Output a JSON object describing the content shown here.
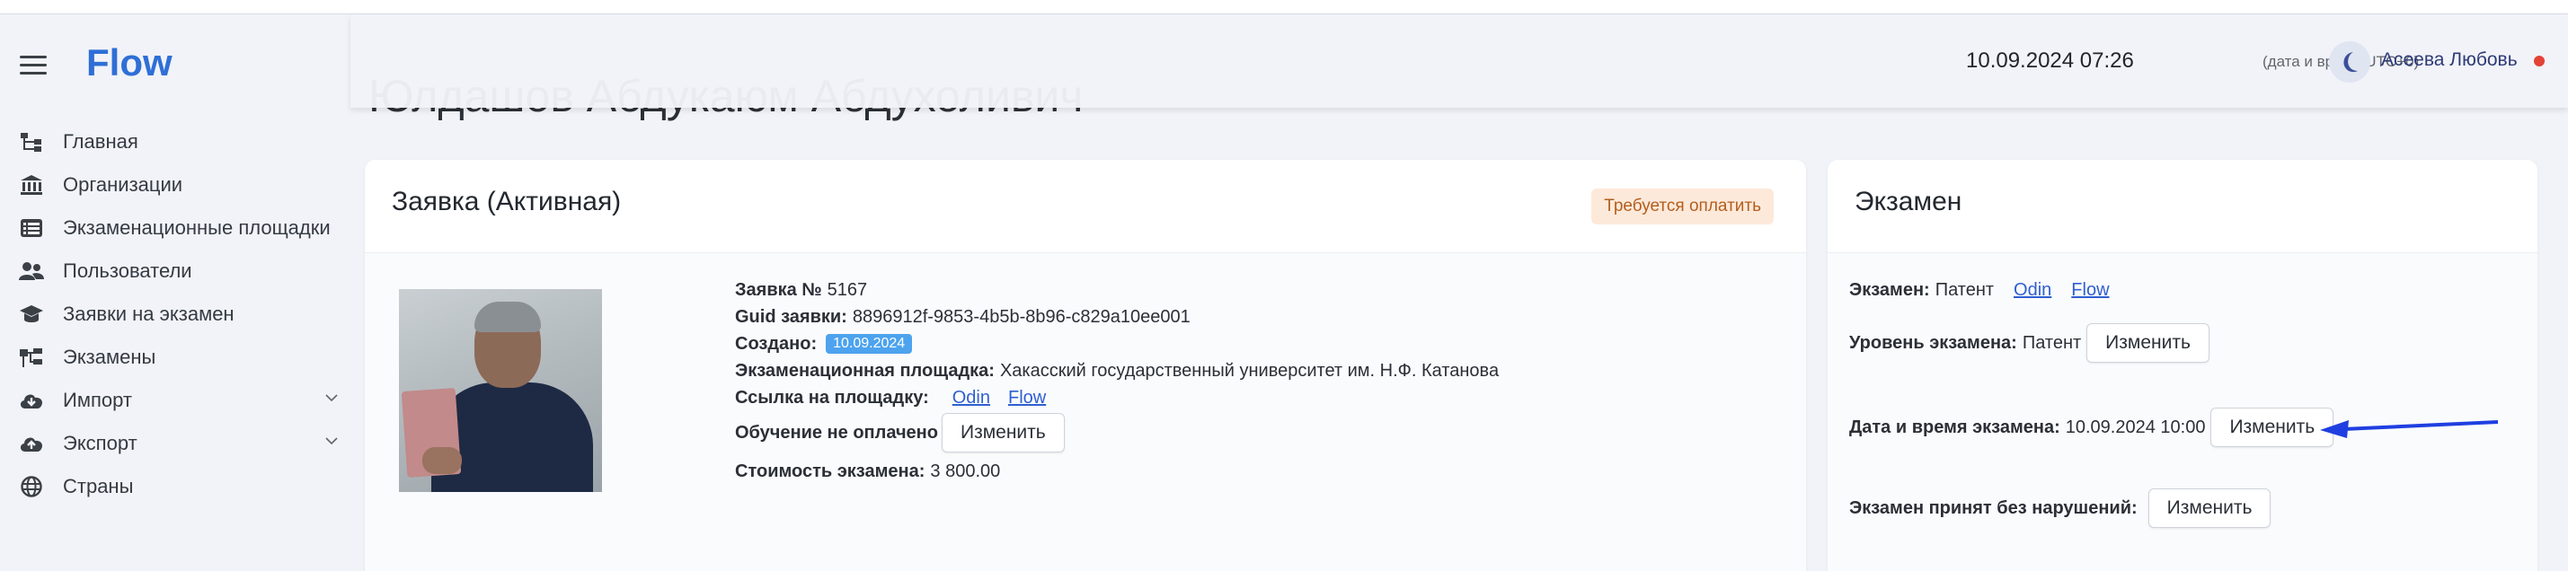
{
  "app": {
    "logo": "Flow"
  },
  "header": {
    "datetime": "10.09.2024 07:26",
    "timezone_note": "(дата и время UTC+0)",
    "user_name": "Асеева Любовь"
  },
  "page_title": "Юлдашов Абдукаюм Абдухоливич",
  "sidebar": {
    "items": [
      {
        "label": "Главная",
        "icon": "tree-icon"
      },
      {
        "label": "Организации",
        "icon": "bank-icon"
      },
      {
        "label": "Экзаменационные площадки",
        "icon": "list-icon"
      },
      {
        "label": "Пользователи",
        "icon": "users-icon"
      },
      {
        "label": "Заявки на экзамен",
        "icon": "graduation-icon"
      },
      {
        "label": "Экзамены",
        "icon": "sitemap-icon"
      },
      {
        "label": "Импорт",
        "icon": "cloud-download-icon"
      },
      {
        "label": "Экспорт",
        "icon": "cloud-upload-icon"
      },
      {
        "label": "Страны",
        "icon": "globe-icon"
      }
    ]
  },
  "application": {
    "title": "Заявка (Активная)",
    "status_badge": "Требуется оплатить",
    "number_label": "Заявка №",
    "number_value": "5167",
    "guid_label": "Guid заявки:",
    "guid_value": "8896912f-9853-4b5b-8b96-c829a10ee001",
    "created_label": "Создано:",
    "created_value": "10.09.2024",
    "site_label": "Экзаменационная площадка:",
    "site_value": "Хакасский государственный университет им. Н.Ф. Катанова",
    "site_link_label": "Ссылка на площадку:",
    "link_odin": "Odin",
    "link_flow": "Flow",
    "training_label": "Обучение не оплачено",
    "change_button": "Изменить",
    "cost_label": "Стоимость экзамена:",
    "cost_value": "3 800.00"
  },
  "exam": {
    "title": "Экзамен",
    "exam_label": "Экзамен:",
    "exam_value": "Патент",
    "link_odin": "Odin",
    "link_flow": "Flow",
    "level_label": "Уровень экзамена:",
    "level_value": "Патент",
    "datetime_label": "Дата и время экзамена:",
    "datetime_value": "10.09.2024 10:00",
    "accepted_label": "Экзамен принят без нарушений:",
    "change_button": "Изменить"
  },
  "colors": {
    "accent": "#2f6fd6",
    "badge_bg": "#fde9da",
    "badge_text": "#b35e1c",
    "chip": "#4da3ee",
    "arrow": "#1f3fe0",
    "status_dot": "#e34234"
  }
}
